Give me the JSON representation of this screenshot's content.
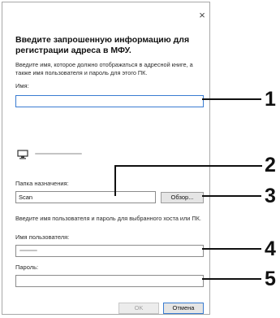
{
  "dialog": {
    "close_glyph": "×",
    "heading": "Введите запрошенную информацию для регистрации адреса в МФУ.",
    "description": "Введите имя, которое должно отображаться в адресной книге, а также имя пользователя и пароль для этого ПК.",
    "name_label": "Имя:",
    "name_value": "",
    "folder_label": "Папка назначения:",
    "folder_value": "Scan",
    "browse_label": "Обзор...",
    "credentials_prompt": "Введите имя пользователя и пароль для выбранного хоста или ПК.",
    "username_label": "Имя пользователя:",
    "password_label": "Пароль:",
    "password_value": "",
    "ok_label": "OK",
    "cancel_label": "Отмена"
  },
  "callouts": [
    "1",
    "2",
    "3",
    "4",
    "5"
  ],
  "icons": {
    "close": "close-icon",
    "computer": "computer-icon"
  },
  "colors": {
    "accent": "#3a7cd1",
    "border": "#8c8c8c",
    "leader": "#111111"
  }
}
